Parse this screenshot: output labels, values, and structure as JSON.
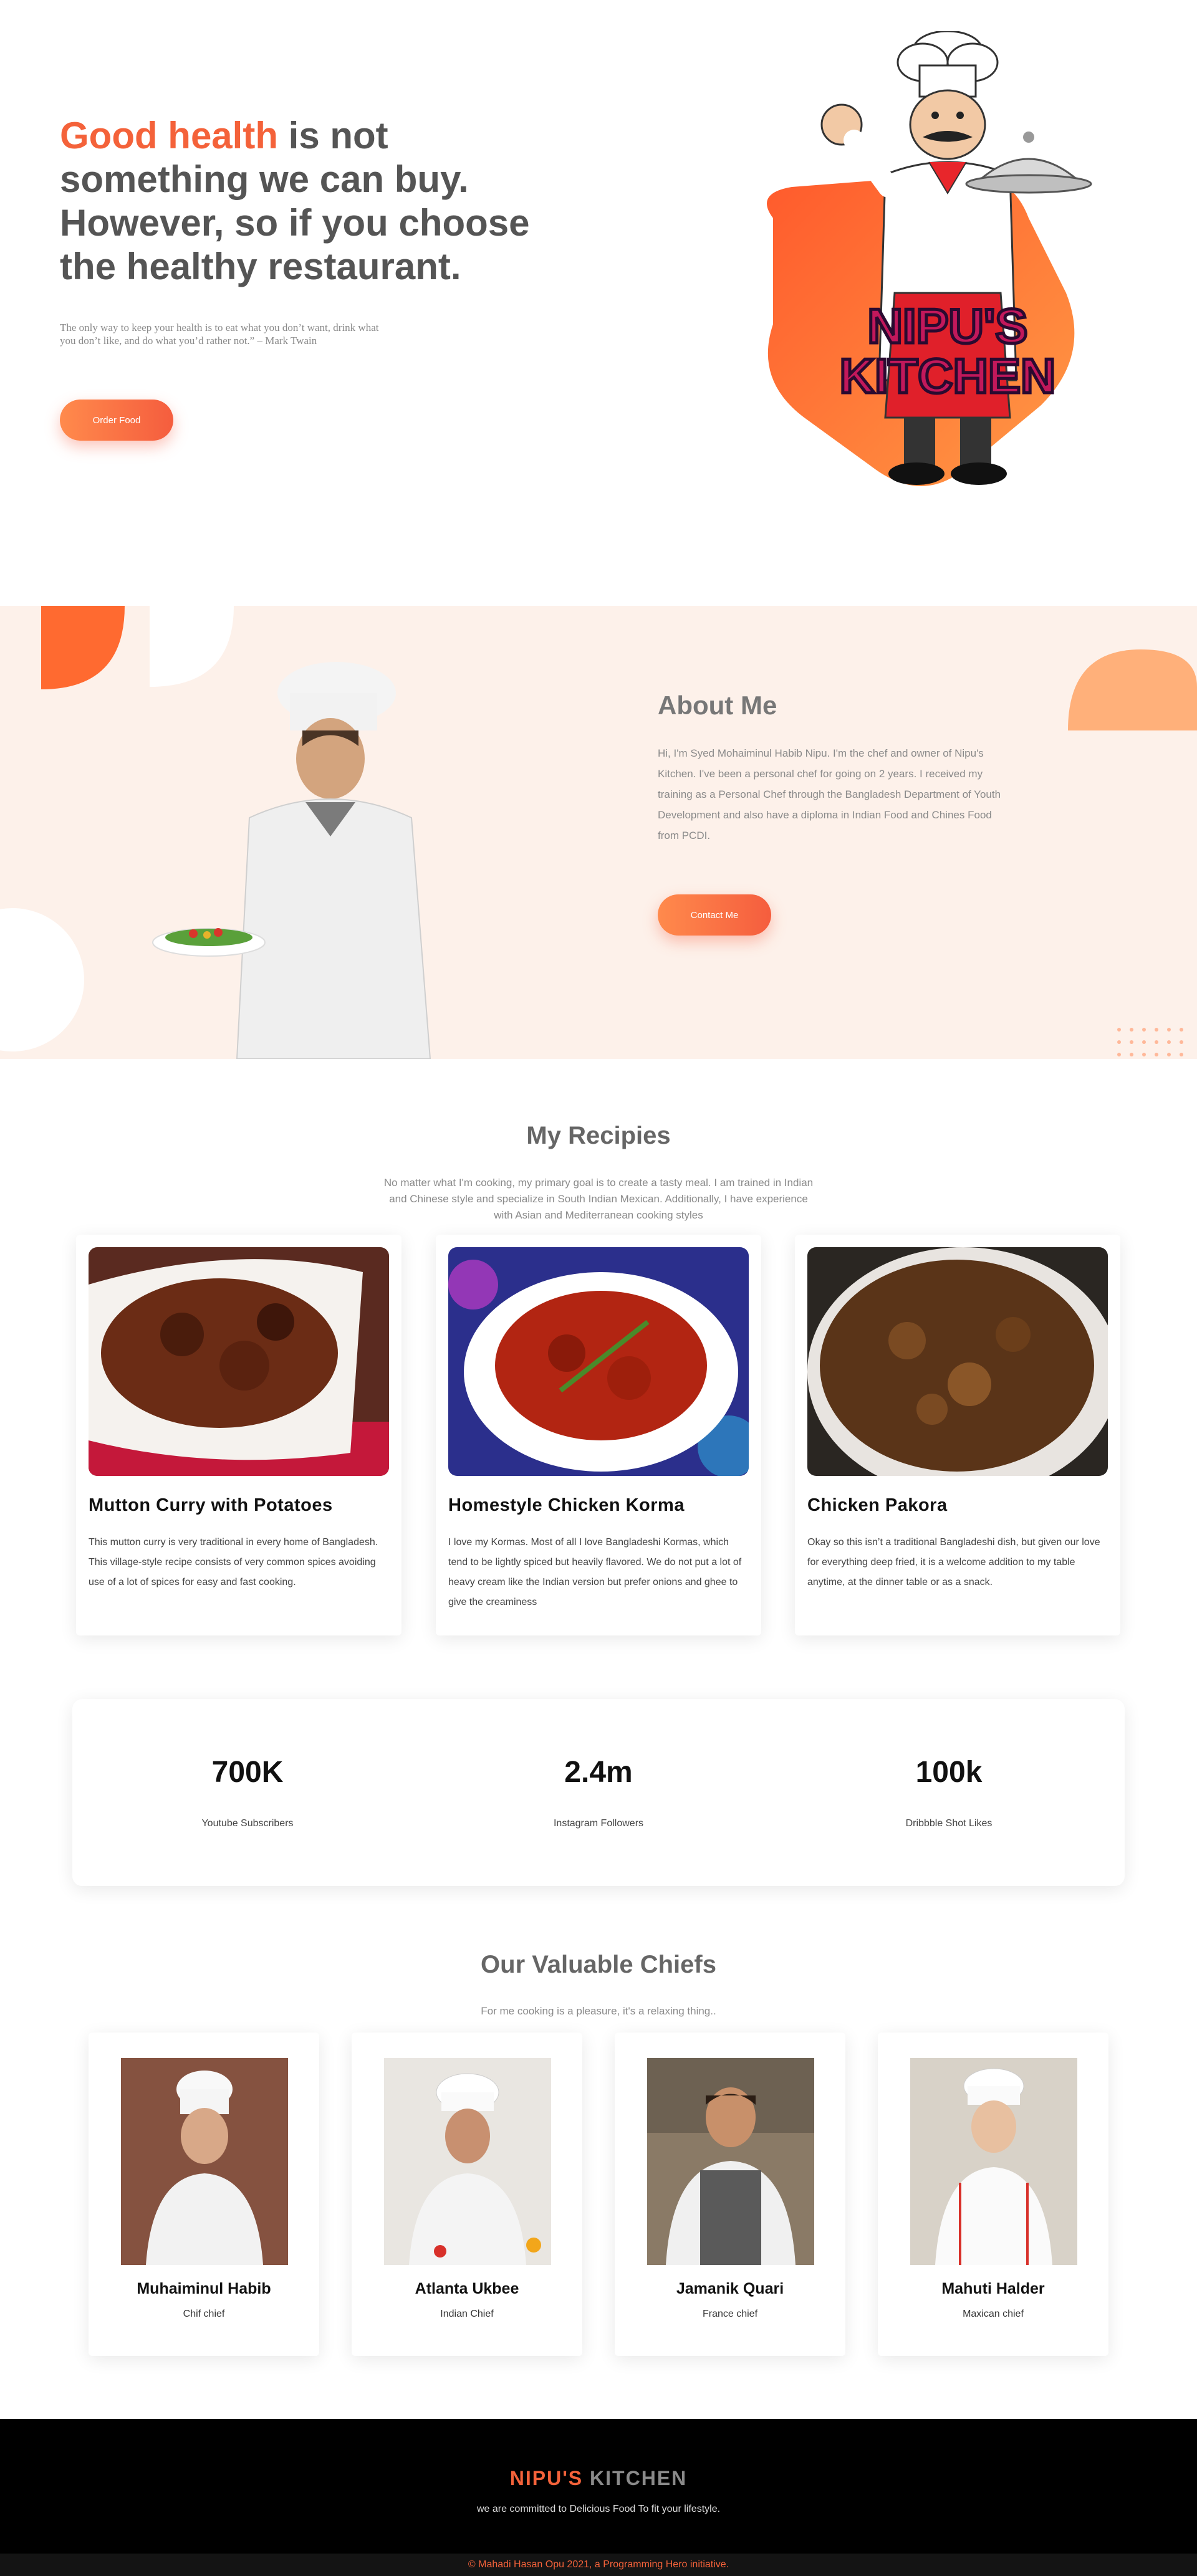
{
  "hero": {
    "title_accent": "Good health",
    "title_rest": " is not something we can buy. However, so if you choose the healthy restaurant.",
    "quote": "The only way to keep your health is to eat what you don’t want, drink what you don’t like, and do what you’d rather not.” – Mark Twain",
    "button": "Order Food",
    "logo_text_1": "NIPU'S",
    "logo_text_2": "KITCHEN"
  },
  "about": {
    "title": "About Me",
    "text": "Hi, I'm Syed Mohaiminul Habib Nipu. I'm the chef and owner of Nipu's Kitchen. I've been a personal chef for going on 2 years. I received my training as a Personal Chef through the Bangladesh Department of Youth Development and also have a diploma in Indian Food and Chines Food from PCDI.",
    "button": "Contact Me"
  },
  "recipes": {
    "title": "My Recipies",
    "subtitle": "No matter what I'm cooking, my primary goal is to create a tasty meal. I am trained in Indian and Chinese style and specialize in South Indian Mexican. Additionally, I have experience with Asian and Mediterranean cooking styles",
    "items": [
      {
        "name": "Mutton Curry with Potatoes",
        "desc": "This mutton curry is very traditional in every home of Bangladesh. This village-style recipe consists of very common spices avoiding use of a lot of spices for easy and fast cooking."
      },
      {
        "name": "Homestyle Chicken Korma",
        "desc": "I love my Kormas. Most of all I love Bangladeshi Kormas, which tend to be lightly spiced but heavily flavored. We do not put a lot of heavy cream like the Indian version but prefer onions and ghee to give the creaminess"
      },
      {
        "name": "Chicken Pakora",
        "desc": "Okay so this isn’t a traditional Bangladeshi dish, but given our love for everything deep fried, it is a welcome addition to my table anytime, at the dinner table or as a snack."
      }
    ]
  },
  "stats": [
    {
      "value": "700K",
      "label": "Youtube Subscribers"
    },
    {
      "value": "2.4m",
      "label": "Instagram Followers"
    },
    {
      "value": "100k",
      "label": "Dribbble Shot Likes"
    }
  ],
  "chiefs": {
    "title": "Our Valuable Chiefs",
    "subtitle": "For me cooking is a pleasure, it's a relaxing thing..",
    "items": [
      {
        "name": "Muhaiminul Habib",
        "role": "Chif chief"
      },
      {
        "name": "Atlanta Ukbee",
        "role": "Indian Chief"
      },
      {
        "name": "Jamanik Quari",
        "role": "France chief"
      },
      {
        "name": "Mahuti Halder",
        "role": "Maxican chief"
      }
    ]
  },
  "footer": {
    "brand_1": "NIPU'S",
    "brand_2": "KITCHEN",
    "tagline": "we are committed to Delicious Food To fit your lifestyle.",
    "copyright": "© Mahadi Hasan Opu 2021, a Programming Hero initiative."
  },
  "colors": {
    "accent": "#f4623a",
    "accent_light": "#ff8a4c",
    "about_bg": "#fdf1ea"
  }
}
